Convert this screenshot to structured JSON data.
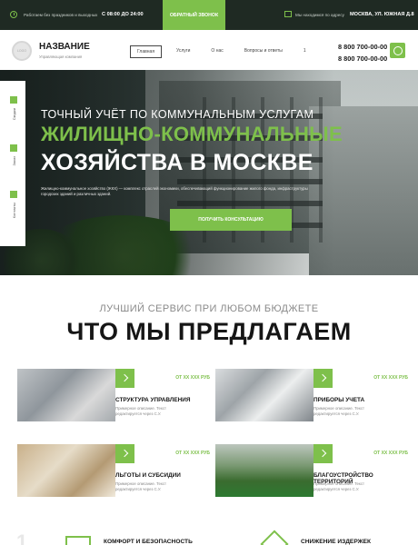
{
  "topbar": {
    "hours_label": "Работаем без праздников и выходных",
    "hours_time": "С 08:00 ДО 24:00",
    "callback_button": "ОБРАТНЫЙ ЗВОНОК",
    "address_label": "Мы находимся по адресу",
    "address": "МОСКВА, УЛ. ЮЖНАЯ Д.8"
  },
  "header": {
    "logo_text": "LOGO",
    "brand_name": "НАЗВАНИЕ",
    "brand_sub": "Управляющая компания",
    "nav": [
      "Главная",
      "Услуги",
      "О нас",
      "Вопросы и ответы",
      "1"
    ],
    "phone1": "8 800 700-00-00",
    "phone2": "8 800 700-00-00"
  },
  "hero": {
    "subtitle": "ТОЧНЫЙ УЧЁТ ПО КОММУНАЛЬНЫМ УСЛУГАМ",
    "title1": "ЖИЛИЩНО-КОММУНАЛЬНЫЕ",
    "title2": "ХОЗЯЙСТВА В МОСКВЕ",
    "description": "Жилищно-коммунальное хозяйство (ЖКХ) — комплекс отраслей экономики, обеспечивающий функционирование жилого фонда, инфраструктуры городских зданий и различных зданий.",
    "cta": "ПОЛУЧИТЬ КОНСУЛЬТАЦИЮ"
  },
  "side": [
    "Скидки",
    "Заказ",
    "Контакты"
  ],
  "services": {
    "subtitle": "ЛУЧШИЙ СЕРВИС ПРИ ЛЮБОМ БЮДЖЕТЕ",
    "title": "ЧТО МЫ ПРЕДЛАГАЕМ",
    "cards": [
      {
        "title": "СТРУКТУРА УПРАВЛЕНИЯ",
        "price": "ОТ XX XXX РУБ",
        "desc": "Примерное описание. Текст редактируется через С.У."
      },
      {
        "title": "ПРИБОРЫ УЧЕТА",
        "price": "ОТ XX XXX РУБ",
        "desc": "Примерное описание. Текст редактируется через С.У."
      },
      {
        "title": "ЛЬГОТЫ И СУБСИДИИ",
        "price": "ОТ XX XXX РУБ",
        "desc": "Примерное описание. Текст редактируется через С.У."
      },
      {
        "title": "БЛАГОУСТРОЙСТВО ТЕРРИТОРИЙ",
        "price": "ОТ XX XXX РУБ",
        "desc": "Примерное описание. Текст редактируется через С.У."
      }
    ]
  },
  "bottom": {
    "number": "1",
    "item1": "КОМФОРТ И БЕЗОПАСНОСТЬ",
    "item2": "СНИЖЕНИЕ ИЗДЕРЖЕК"
  },
  "colors": {
    "accent": "#7ec04b",
    "dark": "#1f2a23"
  }
}
